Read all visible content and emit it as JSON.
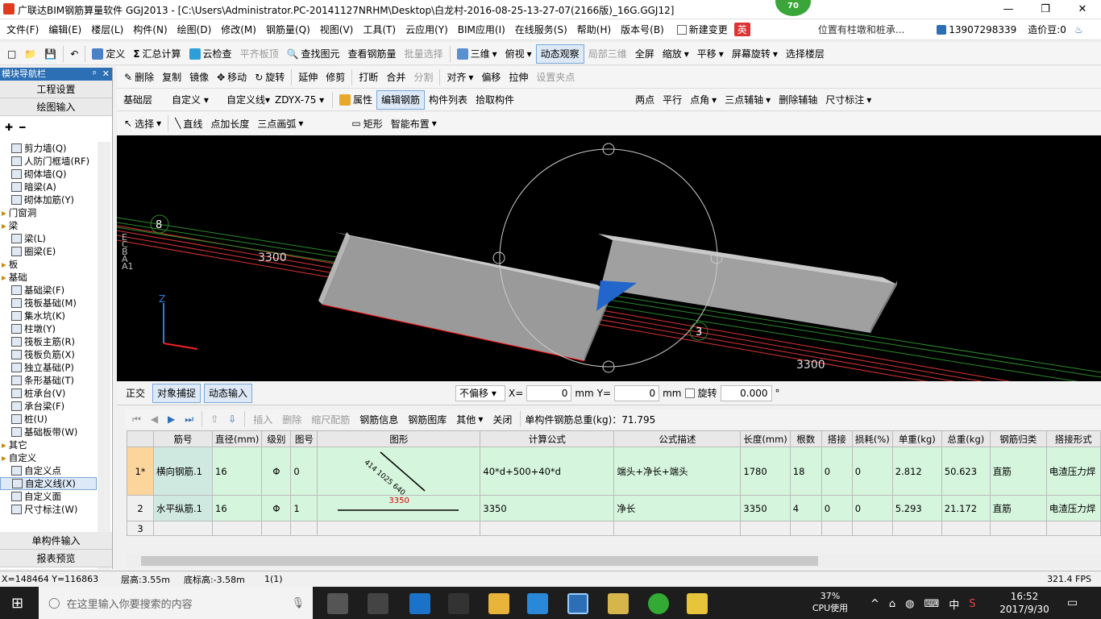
{
  "titlebar": {
    "title": "广联达BIM钢筋算量软件 GGJ2013 - [C:\\Users\\Administrator.PC-20141127NRHM\\Desktop\\白龙村-2016-08-25-13-27-07(2166版)_16G.GGJ12]",
    "minimize": "—",
    "maximize": "❐",
    "close": "✕",
    "badge": "70"
  },
  "menubar": {
    "items": [
      "文件(F)",
      "编辑(E)",
      "楼层(L)",
      "构件(N)",
      "绘图(D)",
      "修改(M)",
      "钢筋量(Q)",
      "视图(V)",
      "工具(T)",
      "云应用(Y)",
      "BIM应用(I)",
      "在线服务(S)",
      "帮助(H)",
      "版本号(B)"
    ],
    "new_change": "新建变更",
    "ime": "英",
    "notice": "位置有柱墩和桩承...",
    "phone": "13907298339",
    "price_bean": "造价豆:0"
  },
  "toolbar1": {
    "define": "定义",
    "sum": "汇总计算",
    "cloud_check": "云检查",
    "align_top": "平齐板顶",
    "find": "查找图元",
    "view_rebar": "查看钢筋量",
    "batch": "批量选择",
    "view3d": "三维",
    "top_view": "俯视",
    "dynamic": "动态观察",
    "local3d": "局部三维",
    "fullscreen": "全屏",
    "zoom": "缩放",
    "pan": "平移",
    "rotate_screen": "屏幕旋转",
    "select_floor": "选择楼层"
  },
  "toolbar2": {
    "delete": "删除",
    "copy": "复制",
    "mirror": "镜像",
    "move": "移动",
    "rotate": "旋转",
    "extend": "延伸",
    "trim": "修剪",
    "break": "打断",
    "merge": "合并",
    "split": "分割",
    "align": "对齐",
    "offset": "偏移",
    "stretch": "拉伸",
    "grip": "设置夹点"
  },
  "toolbar3": {
    "layer": "基础层",
    "custom": "自定义",
    "custom_line": "自定义线",
    "code": "ZDYX-75",
    "props": "属性",
    "edit_rebar": "编辑钢筋",
    "comp_list": "构件列表",
    "pick": "拾取构件",
    "two_point": "两点",
    "parallel": "平行",
    "point_angle": "点角",
    "three_axis": "三点辅轴",
    "del_axis": "删除辅轴",
    "dim": "尺寸标注"
  },
  "toolbar4": {
    "select": "选择",
    "line": "直线",
    "point_len": "点加长度",
    "arc": "三点画弧",
    "rect": "矩形",
    "smart": "智能布置"
  },
  "leftpanel": {
    "title": "模块导航栏",
    "pin": "ᵖ",
    "close": "✕",
    "proj_settings": "工程设置",
    "draw_input": "绘图输入",
    "single_input": "单构件输入",
    "report": "报表预览",
    "tree": [
      {
        "label": "剪力墙(Q)",
        "lv": 1
      },
      {
        "label": "人防门框墙(RF)",
        "lv": 1
      },
      {
        "label": "砌体墙(Q)",
        "lv": 1
      },
      {
        "label": "暗梁(A)",
        "lv": 1
      },
      {
        "label": "砌体加筋(Y)",
        "lv": 1
      },
      {
        "label": "门窗洞",
        "lv": 0
      },
      {
        "label": "梁",
        "lv": 0
      },
      {
        "label": "梁(L)",
        "lv": 1
      },
      {
        "label": "圈梁(E)",
        "lv": 1
      },
      {
        "label": "板",
        "lv": 0
      },
      {
        "label": "基础",
        "lv": 0
      },
      {
        "label": "基础梁(F)",
        "lv": 1
      },
      {
        "label": "筏板基础(M)",
        "lv": 1
      },
      {
        "label": "集水坑(K)",
        "lv": 1
      },
      {
        "label": "柱墩(Y)",
        "lv": 1
      },
      {
        "label": "筏板主筋(R)",
        "lv": 1
      },
      {
        "label": "筏板负筋(X)",
        "lv": 1
      },
      {
        "label": "独立基础(P)",
        "lv": 1
      },
      {
        "label": "条形基础(T)",
        "lv": 1
      },
      {
        "label": "桩承台(V)",
        "lv": 1
      },
      {
        "label": "承台梁(F)",
        "lv": 1
      },
      {
        "label": "桩(U)",
        "lv": 1
      },
      {
        "label": "基础板带(W)",
        "lv": 1
      },
      {
        "label": "其它",
        "lv": 0
      },
      {
        "label": "自定义",
        "lv": 0
      },
      {
        "label": "自定义点",
        "lv": 1
      },
      {
        "label": "自定义线(X)",
        "lv": 1
      },
      {
        "label": "自定义面",
        "lv": 1
      },
      {
        "label": "尺寸标注(W)",
        "lv": 1
      }
    ]
  },
  "viewport": {
    "dim1": "3300",
    "dim2": "3300",
    "axis8": "8",
    "axis3": "3",
    "axes_left": [
      "E",
      "C",
      "B",
      "A",
      "A1"
    ],
    "z": "Z"
  },
  "snapbar": {
    "ortho": "正交",
    "obj_snap": "对象捕捉",
    "dyn_input": "动态输入",
    "offset": "不偏移",
    "x_label": "X=",
    "x_val": "0",
    "mm1": "mm",
    "y_label": "Y=",
    "y_val": "0",
    "mm2": "mm",
    "rotate": "旋转",
    "rot_val": "0.000",
    "deg": "°"
  },
  "gridbar": {
    "insert": "插入",
    "delete": "删除",
    "scale": "缩尺配筋",
    "rebar_info": "钢筋信息",
    "rebar_lib": "钢筋图库",
    "other": "其他",
    "close": "关闭",
    "total": "单构件钢筋总重(kg)：71.795"
  },
  "grid": {
    "headers": [
      "",
      "筋号",
      "直径(mm)",
      "级别",
      "图号",
      "图形",
      "计算公式",
      "公式描述",
      "长度(mm)",
      "根数",
      "搭接",
      "损耗(%)",
      "单重(kg)",
      "总重(kg)",
      "钢筋归类",
      "搭接形式"
    ],
    "rows": [
      [
        "1*",
        "横向钢筋.1",
        "16",
        "Φ",
        "0",
        "",
        "40*d+500+40*d",
        "端头+净长+端头",
        "1780",
        "18",
        "0",
        "0",
        "2.812",
        "50.623",
        "直筋",
        "电渣压力焊"
      ],
      [
        "2",
        "水平纵筋.1",
        "16",
        "Φ",
        "1",
        "",
        "3350",
        "净长",
        "3350",
        "4",
        "0",
        "0",
        "5.293",
        "21.172",
        "直筋",
        "电渣压力焊"
      ],
      [
        "3",
        "",
        "",
        "",
        "",
        "",
        "",
        "",
        "",
        "",
        "",
        "",
        "",
        "",
        "",
        ""
      ]
    ],
    "shape1": "414 1025 640",
    "shape2": "3350"
  },
  "status": {
    "coords": "X=148464 Y=116863",
    "floor_h": "层高:3.55m",
    "base_h": "底标高:-3.58m",
    "count": "1(1)",
    "fps": "321.4 FPS"
  },
  "taskbar": {
    "search": "在这里输入你要搜索的内容",
    "cpu": "37%",
    "cpu_label": "CPU使用",
    "ime": "中",
    "time": "16:52",
    "date": "2017/9/30"
  },
  "colors": {
    "accent": "#2d6fb4",
    "row_green": "#d6f5dd",
    "selected": "#fbd59c"
  }
}
